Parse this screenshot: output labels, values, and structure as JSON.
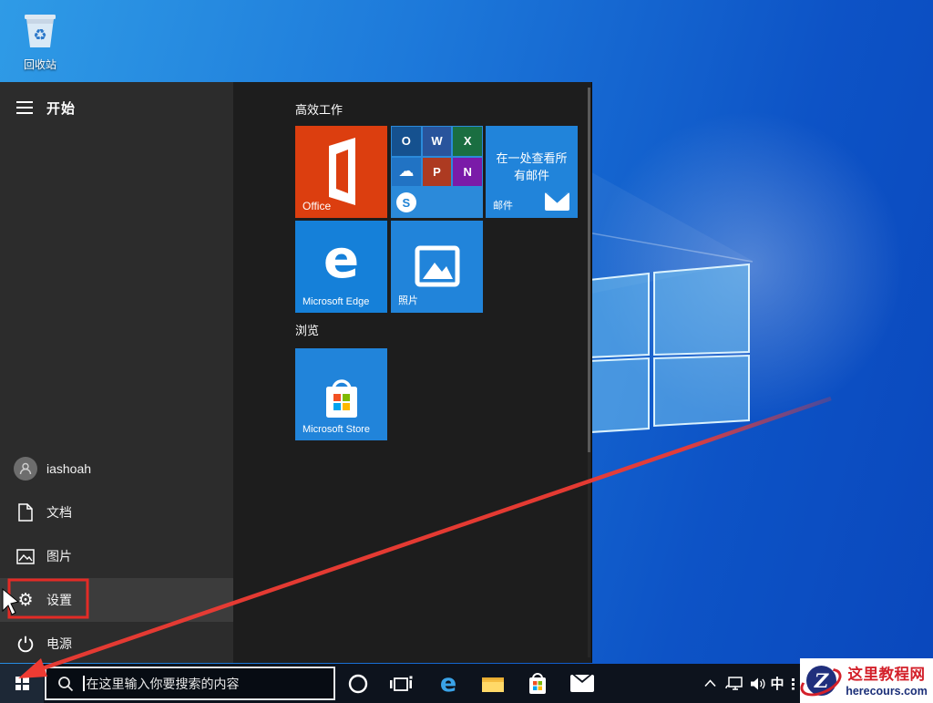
{
  "desktop": {
    "recycle_bin_label": "回收站"
  },
  "start_menu": {
    "title": "开始",
    "groups": {
      "productivity": "高效工作",
      "explore": "浏览"
    },
    "tiles": {
      "office": {
        "label": "Office",
        "color": "#dc3e0f"
      },
      "office_folder": {
        "apps": [
          {
            "name": "Outlook",
            "glyph": "O"
          },
          {
            "name": "Word",
            "glyph": "W"
          },
          {
            "name": "Excel",
            "glyph": "X"
          },
          {
            "name": "OneDrive",
            "glyph": "☁"
          },
          {
            "name": "PowerPoint",
            "glyph": "P"
          },
          {
            "name": "OneNote",
            "glyph": "N"
          },
          {
            "name": "Skype",
            "glyph": "S"
          }
        ]
      },
      "mail": {
        "headline": "在一处查看所有邮件",
        "label": "邮件"
      },
      "edge": {
        "label": "Microsoft Edge",
        "glyph": "e"
      },
      "photos": {
        "label": "照片"
      },
      "store": {
        "label": "Microsoft Store"
      }
    },
    "sidebar": [
      {
        "label": "iashoah",
        "icon": "user-avatar"
      },
      {
        "label": "文档",
        "icon": "document-icon"
      },
      {
        "label": "图片",
        "icon": "pictures-icon"
      },
      {
        "label": "设置",
        "icon": "settings-gear-icon",
        "highlighted": true
      },
      {
        "label": "电源",
        "icon": "power-icon"
      }
    ],
    "gear_glyph": "⚙"
  },
  "taskbar": {
    "search_placeholder": "在这里输入你要搜索的内容",
    "edge_glyph": "e",
    "tray": {
      "ime_label": "中"
    }
  },
  "watermark": {
    "site_name": "这里教程网",
    "site_domain": "herecours.com",
    "logo_letter": "Z",
    "name_color": "#d3202a",
    "domain_color": "#1b2f78"
  },
  "colors": {
    "desktop_accent": "#1d79da",
    "menu_left": "#2c2c2c",
    "menu_tiles_bg": "#1d1d1d",
    "tile_blue": "#2184da",
    "office_orange": "#dc3e0f",
    "taskbar": "#0d131d",
    "annotation_red": "#ee3b33"
  }
}
